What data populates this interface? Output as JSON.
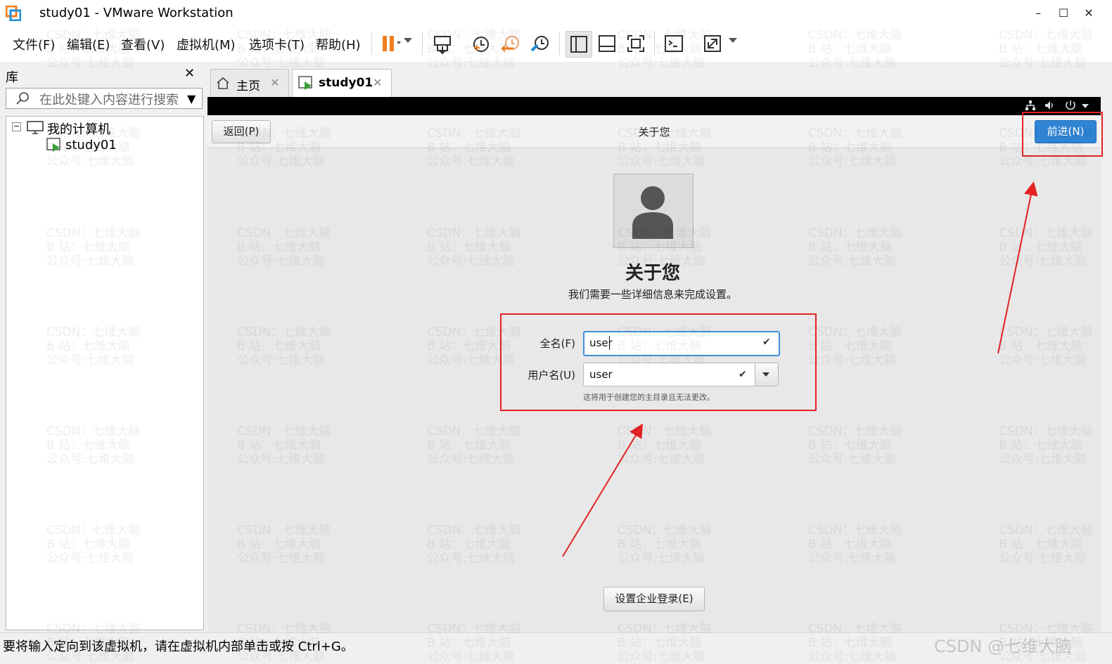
{
  "window": {
    "title": "study01 - VMware Workstation",
    "controls": {
      "minimize": "–",
      "maximize": "☐",
      "close": "✕"
    }
  },
  "menu": {
    "items": [
      "文件(F)",
      "编辑(E)",
      "查看(V)",
      "虚拟机(M)",
      "选项卡(T)",
      "帮助(H)"
    ]
  },
  "toolbar": {
    "icons": [
      "pause-icon",
      "send-keys-icon",
      "snapshot-icon",
      "revert-snapshot-icon",
      "snapshot-manager-icon",
      "library-view-icon",
      "thumbnail-view-icon",
      "fullscreen-icon",
      "console-icon",
      "stretch-icon"
    ],
    "accent": "#f07e20"
  },
  "library": {
    "title": "库",
    "close": "✕",
    "search_placeholder": "在此处键入内容进行搜索",
    "tree": {
      "root_toggle": "−",
      "root_label": "我的计算机",
      "children": [
        "study01"
      ]
    }
  },
  "tabs": [
    {
      "label": "主页",
      "icon": "home-icon",
      "close": "✕",
      "active": false
    },
    {
      "label": "study01",
      "icon": "vm-running-icon",
      "close": "✕",
      "active": true
    }
  ],
  "guest": {
    "header": {
      "back_button": "返回(P)",
      "title": "关于您",
      "next_button": "前进(N)"
    },
    "page": {
      "heading": "关于您",
      "subtitle": "我们需要一些详细信息来完成设置。",
      "fullname_label": "全名(F)",
      "fullname_value": "user",
      "username_label": "用户名(U)",
      "username_value": "user",
      "hint": "这将用于创建您的主目录且无法更改。",
      "enterprise_button": "设置企业登录(E)"
    },
    "colors": {
      "primary_button": "#2f84d4",
      "annotation": "#e52222"
    }
  },
  "statusbar": {
    "text": "要将输入定向到该虚拟机，请在虚拟机内部单击或按 Ctrl+G。",
    "corner_mark": "CSDN @七维大脑"
  },
  "watermark": {
    "lines": "CSDN：七维大脑\nB 站：七维大脑\n公众号:七维大脑"
  }
}
